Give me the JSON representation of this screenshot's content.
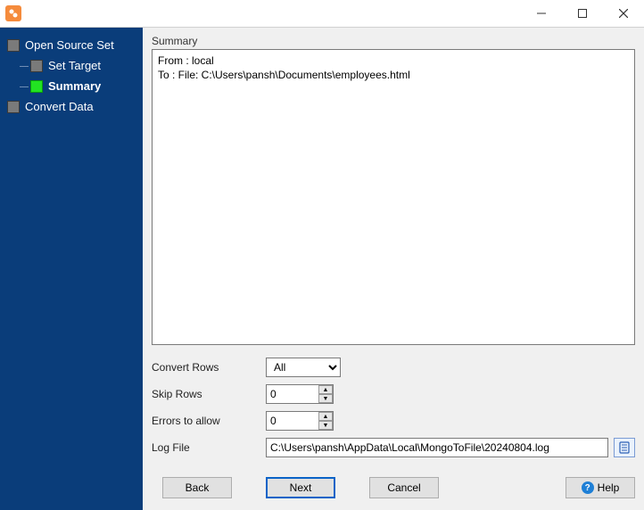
{
  "titlebar": {
    "app_icon": "app-icon"
  },
  "sidebar": {
    "items": [
      {
        "label": "Open Source Set",
        "level": "root",
        "active": false
      },
      {
        "label": "Set Target",
        "level": "child",
        "active": false
      },
      {
        "label": "Summary",
        "level": "child",
        "active": true
      },
      {
        "label": "Convert Data",
        "level": "root",
        "active": false
      }
    ]
  },
  "summary": {
    "group_label": "Summary",
    "text": "From : local\nTo : File: C:\\Users\\pansh\\Documents\\employees.html"
  },
  "form": {
    "convert_rows": {
      "label": "Convert Rows",
      "value": "All"
    },
    "skip_rows": {
      "label": "Skip Rows",
      "value": "0"
    },
    "errors_allow": {
      "label": "Errors to allow",
      "value": "0"
    },
    "log_file": {
      "label": "Log File",
      "value": "C:\\Users\\pansh\\AppData\\Local\\MongoToFile\\20240804.log"
    }
  },
  "buttons": {
    "back": "Back",
    "next": "Next",
    "cancel": "Cancel",
    "help": "Help"
  }
}
